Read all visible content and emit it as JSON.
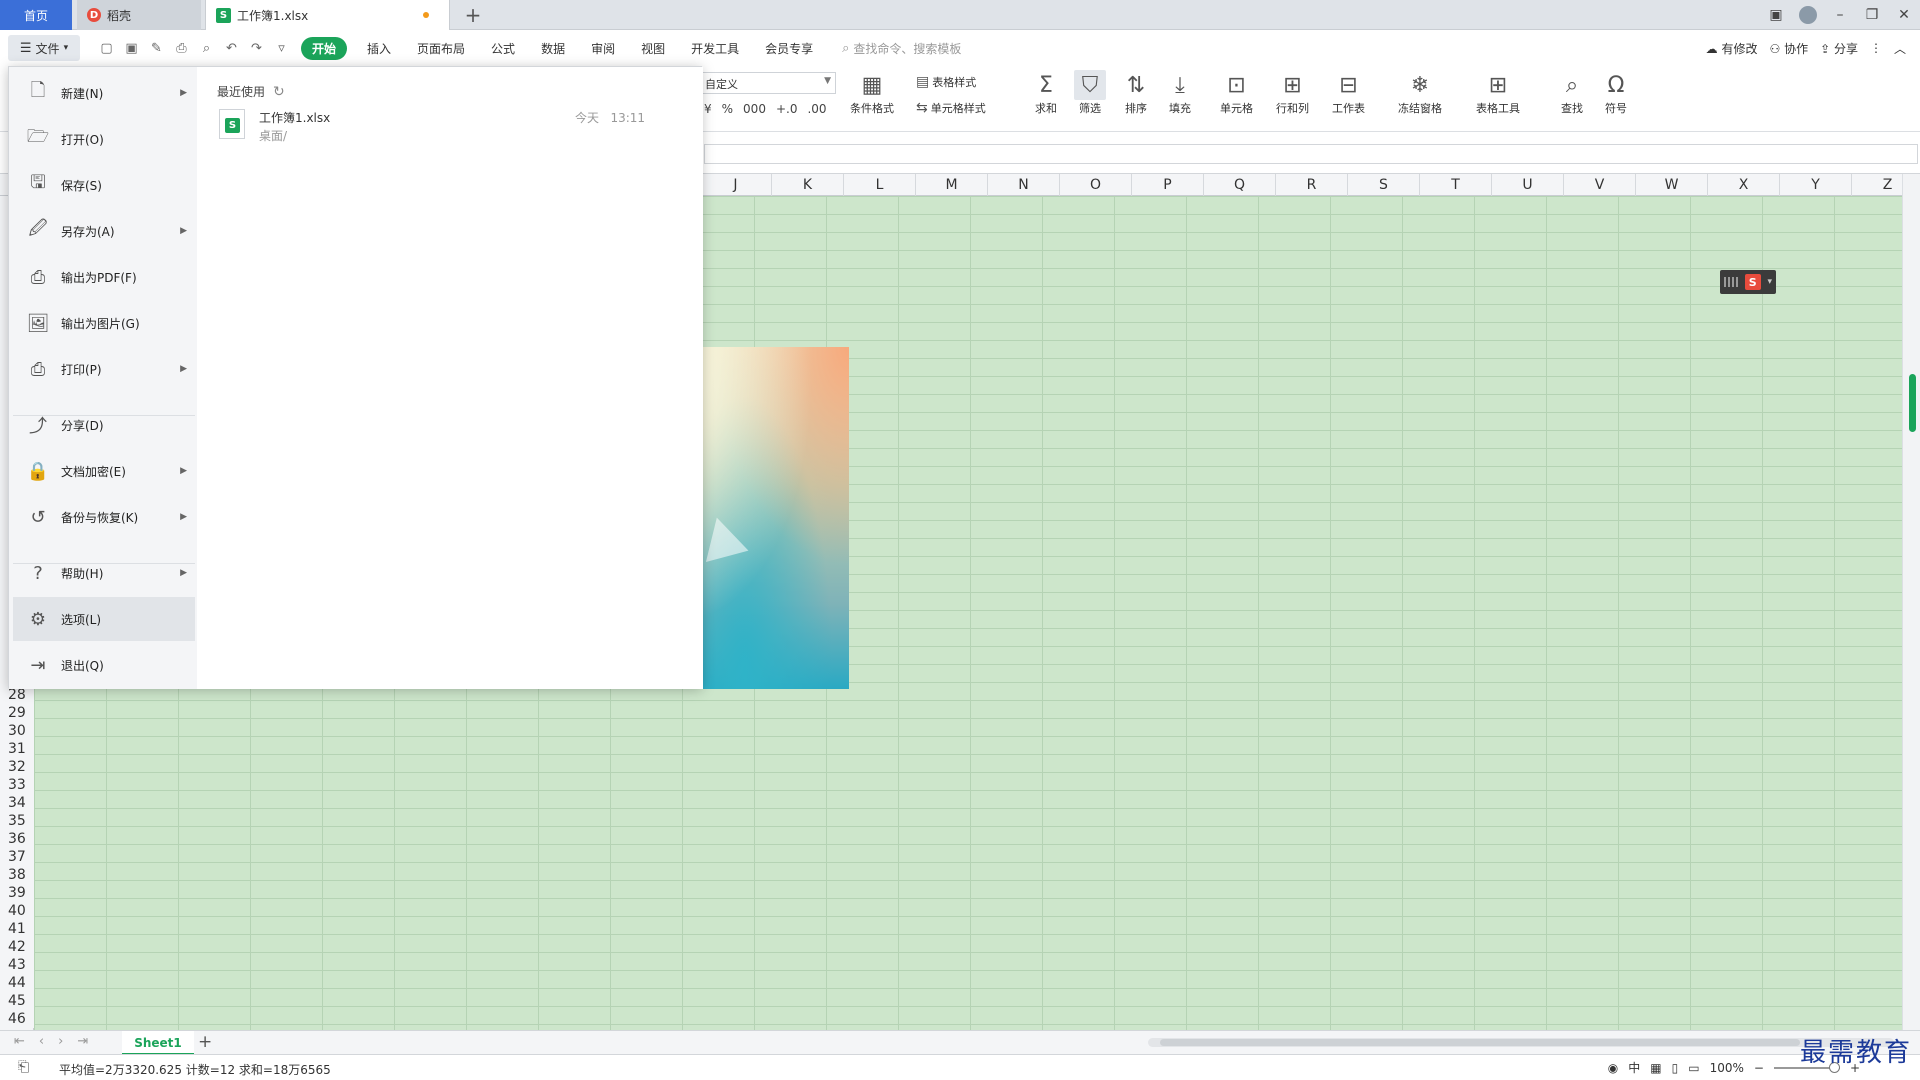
{
  "window": {
    "tabs": [
      {
        "label": "首页"
      },
      {
        "label": "稻壳",
        "logo": "D"
      },
      {
        "label": "工作簿1.xlsx",
        "logo": "S"
      }
    ],
    "add_tab": "+",
    "controls": {
      "minimize": "–",
      "restore": "❐",
      "close": "✕",
      "panel": "▣"
    }
  },
  "menubar": {
    "file_label": "文件",
    "ribbon_tabs": [
      "开始",
      "插入",
      "页面布局",
      "公式",
      "数据",
      "审阅",
      "视图",
      "开发工具",
      "会员专享"
    ],
    "search_placeholder": "查找命令、搜索模板",
    "right_actions": {
      "modified": "有修改",
      "collab": "协作",
      "share": "分享"
    }
  },
  "ribbon": {
    "number_format": "自定义",
    "num_icons": [
      "¥",
      "%",
      "000",
      "+.0",
      ".00"
    ],
    "table_style": "表格样式",
    "cell_style": "单元格样式",
    "cond_format": "条件格式",
    "buttons": [
      "求和",
      "筛选",
      "排序",
      "填充",
      "单元格",
      "行和列",
      "工作表",
      "冻结窗格",
      "表格工具",
      "查找",
      "符号"
    ]
  },
  "grid": {
    "columns": [
      "J",
      "K",
      "L",
      "M",
      "N",
      "O",
      "P",
      "Q",
      "R",
      "S",
      "T",
      "U",
      "V",
      "W",
      "X",
      "Y",
      "Z"
    ],
    "rows": [
      "28",
      "29",
      "30",
      "31",
      "32",
      "33",
      "34",
      "35",
      "36",
      "37",
      "38",
      "39",
      "40",
      "41",
      "42",
      "43",
      "44",
      "45",
      "46"
    ]
  },
  "file_menu": {
    "items": [
      {
        "label": "新建(N)",
        "icon": "new-file-icon",
        "has_sub": true
      },
      {
        "label": "打开(O)",
        "icon": "folder-open-icon",
        "has_sub": false
      },
      {
        "label": "保存(S)",
        "icon": "save-icon",
        "has_sub": false
      },
      {
        "label": "另存为(A)",
        "icon": "save-as-icon",
        "has_sub": true
      },
      {
        "label": "输出为PDF(F)",
        "icon": "pdf-icon",
        "has_sub": false
      },
      {
        "label": "输出为图片(G)",
        "icon": "image-icon",
        "has_sub": false
      },
      {
        "label": "打印(P)",
        "icon": "print-icon",
        "has_sub": true
      },
      {
        "label": "分享(D)",
        "icon": "share-icon",
        "has_sub": false
      },
      {
        "label": "文档加密(E)",
        "icon": "lock-doc-icon",
        "has_sub": true
      },
      {
        "label": "备份与恢复(K)",
        "icon": "backup-icon",
        "has_sub": true
      },
      {
        "label": "帮助(H)",
        "icon": "help-icon",
        "has_sub": true
      },
      {
        "label": "选项(L)",
        "icon": "gear-icon",
        "has_sub": false
      },
      {
        "label": "退出(Q)",
        "icon": "exit-icon",
        "has_sub": false
      }
    ],
    "recent_title": "最近使用",
    "recent_files": [
      {
        "name": "工作簿1.xlsx",
        "path": "桌面/",
        "date": "今天",
        "time": "13:11"
      }
    ]
  },
  "sheets": {
    "tabs": [
      "Sheet1"
    ],
    "add": "+"
  },
  "statusbar": {
    "stats": "平均值=2万3320.625  计数=12  求和=18万6565",
    "input_mode": "中",
    "zoom": "100%"
  },
  "watermark": "最需教育",
  "colors": {
    "accent": "#1ba45a",
    "home_tab": "#3b6fd8",
    "grid_bg": "#cde6cb"
  }
}
